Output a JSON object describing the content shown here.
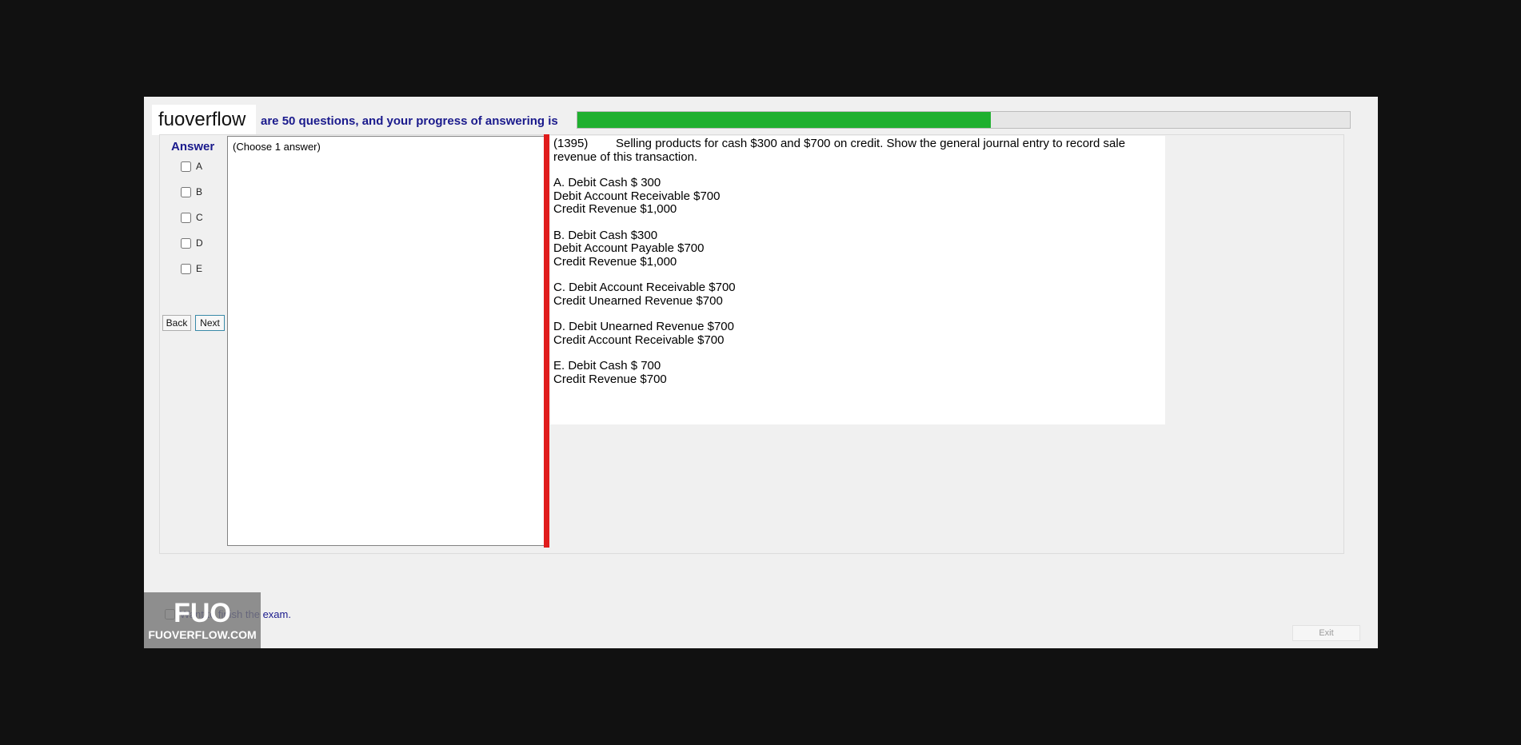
{
  "header": {
    "logo_text": "fuoverflow",
    "progress_text": "are 50 questions, and your progress of answering is",
    "progress_fraction": 0.535
  },
  "answer_panel": {
    "title": "Answer",
    "options": [
      "A",
      "B",
      "C",
      "D",
      "E"
    ],
    "back_label": "Back",
    "next_label": "Next"
  },
  "choose_hint": "(Choose 1 answer)",
  "question": {
    "id": "(1395)",
    "text_line1": "Selling products for cash $300 and $700 on credit. Show the general journal entry to record sale",
    "text_line2": "revenue of this transaction.",
    "choices": [
      [
        "A.  Debit Cash $ 300",
        "Debit Account Receivable $700",
        "Credit Revenue $1,000"
      ],
      [
        "B.  Debit Cash $300",
        "Debit Account Payable $700",
        "Credit Revenue $1,000"
      ],
      [
        "C.  Debit Account Receivable $700",
        "Credit Unearned Revenue $700"
      ],
      [
        "D.  Debit Unearned Revenue $700",
        "Credit Account Receivable $700"
      ],
      [
        "E.  Debit Cash $ 700",
        "Credit Revenue $700"
      ]
    ]
  },
  "footer": {
    "finish_label": "Want to finish the exam.",
    "exit_label": "Exit",
    "watermark_big": "FUO",
    "watermark_small": "FUOVERFLOW.COM"
  },
  "colors": {
    "progress_fill": "#1fb02f",
    "splitter": "#e01c1c",
    "label_blue": "#1a1a8c"
  }
}
